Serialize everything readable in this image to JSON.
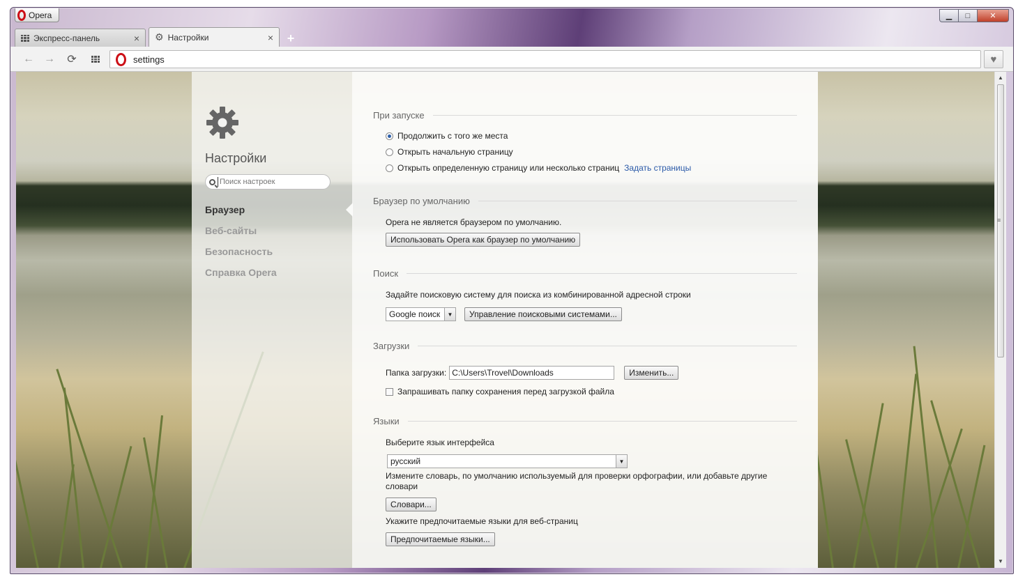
{
  "window": {
    "app_name": "Opera",
    "controls": {
      "minimize": "▁",
      "maximize": "□",
      "close": "✕"
    }
  },
  "tabs": [
    {
      "label": "Экспресс-панель",
      "icon": "grid-icon",
      "active": false
    },
    {
      "label": "Настройки",
      "icon": "gear-icon",
      "active": true
    }
  ],
  "new_tab": "+",
  "toolbar": {
    "back": "←",
    "forward": "→",
    "reload": "⟳",
    "grid": "grid-icon",
    "address": "settings",
    "heart": "♥"
  },
  "sidebar": {
    "title": "Настройки",
    "search_placeholder": "Поиск настроек",
    "items": [
      {
        "label": "Браузер",
        "active": true
      },
      {
        "label": "Веб-сайты",
        "active": false
      },
      {
        "label": "Безопасность",
        "active": false
      },
      {
        "label": "Справка Opera",
        "active": false
      }
    ]
  },
  "startup": {
    "heading": "При запуске",
    "options": [
      {
        "label": "Продолжить с того же места",
        "checked": true
      },
      {
        "label": "Открыть начальную страницу",
        "checked": false
      },
      {
        "label": "Открыть определенную страницу или несколько страниц",
        "checked": false
      }
    ],
    "set_pages_link": "Задать страницы"
  },
  "default_browser": {
    "heading": "Браузер по умолчанию",
    "status": "Opera не является браузером по умолчанию.",
    "button": "Использовать Opera как браузер по умолчанию"
  },
  "search": {
    "heading": "Поиск",
    "description": "Задайте поисковую систему для поиска из комбинированной адресной строки",
    "engine": "Google поиск",
    "manage_button": "Управление поисковыми системами..."
  },
  "downloads": {
    "heading": "Загрузки",
    "folder_label": "Папка загрузки:",
    "folder_path": "C:\\Users\\Trovel\\Downloads",
    "change_button": "Изменить...",
    "ask_label": "Запрашивать папку сохранения перед загрузкой файла",
    "ask_checked": false
  },
  "languages": {
    "heading": "Языки",
    "interface_label": "Выберите язык интерфейса",
    "interface_value": "русский",
    "dictionary_text": "Измените словарь, по умолчанию используемый для проверки орфографии, или добавьте другие словари",
    "dictionaries_button": "Словари...",
    "preferred_text": "Укажите предпочитаемые языки для веб-страниц",
    "preferred_button": "Предпочитаемые языки..."
  },
  "colors": {
    "opera_red": "#cc0f16",
    "link_blue": "#2b5aa8"
  }
}
